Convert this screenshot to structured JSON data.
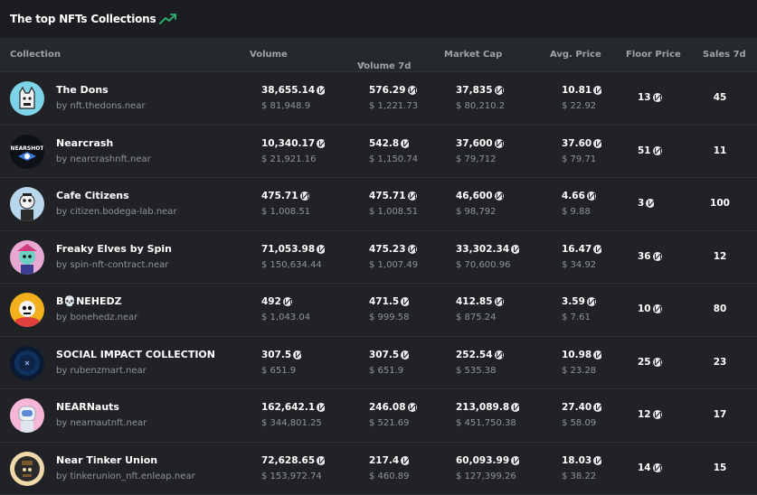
{
  "header": {
    "title": "The top NFTs Collections"
  },
  "icons": {
    "trend": "trending-up-icon",
    "near": "near-token-icon",
    "sort": "sort-ascending-icon"
  },
  "colors": {
    "accent": "#2bb673",
    "background": "#1b1d20",
    "header_row": "#25282c"
  },
  "columns": {
    "collection": "Collection",
    "volume": "Volume",
    "volume_7d": "Volume 7d",
    "market_cap": "Market Cap",
    "avg_price": "Avg. Price",
    "floor_price": "Floor Price",
    "sales_7d": "Sales 7d"
  },
  "rows": [
    {
      "name": "The Dons",
      "contract": "by nft.thedons.near",
      "volume": "38,655.14",
      "volume_usd": "$ 81,948.9",
      "volume_7d": "576.29",
      "volume_7d_usd": "$ 1,221.73",
      "market_cap": "37,835",
      "market_cap_usd": "$ 80,210.2",
      "avg_price": "10.81",
      "avg_price_usd": "$ 22.92",
      "floor": "13",
      "sales": "45"
    },
    {
      "name": "Nearcrash",
      "contract": "by nearcrashnft.near",
      "volume": "10,340.17",
      "volume_usd": "$ 21,921.16",
      "volume_7d": "542.8",
      "volume_7d_usd": "$ 1,150.74",
      "market_cap": "37,600",
      "market_cap_usd": "$ 79,712",
      "avg_price": "37.60",
      "avg_price_usd": "$ 79.71",
      "floor": "51",
      "sales": "11"
    },
    {
      "name": "Cafe Citizens",
      "contract": "by citizen.bodega-lab.near",
      "volume": "475.71",
      "volume_usd": "$ 1,008.51",
      "volume_7d": "475.71",
      "volume_7d_usd": "$ 1,008.51",
      "market_cap": "46,600",
      "market_cap_usd": "$ 98,792",
      "avg_price": "4.66",
      "avg_price_usd": "$ 9.88",
      "floor": "3",
      "sales": "100"
    },
    {
      "name": "Freaky Elves by Spin",
      "contract": "by spin-nft-contract.near",
      "volume": "71,053.98",
      "volume_usd": "$ 150,634.44",
      "volume_7d": "475.23",
      "volume_7d_usd": "$ 1,007.49",
      "market_cap": "33,302.34",
      "market_cap_usd": "$ 70,600.96",
      "avg_price": "16.47",
      "avg_price_usd": "$ 34.92",
      "floor": "36",
      "sales": "12"
    },
    {
      "name": "B💀NEHEDZ",
      "contract": "by bonehedz.near",
      "volume": "492",
      "volume_usd": "$ 1,043.04",
      "volume_7d": "471.5",
      "volume_7d_usd": "$ 999.58",
      "market_cap": "412.85",
      "market_cap_usd": "$ 875.24",
      "avg_price": "3.59",
      "avg_price_usd": "$ 7.61",
      "floor": "10",
      "sales": "80"
    },
    {
      "name": "SOCIAL IMPACT COLLECTION",
      "contract": "by rubenzmart.near",
      "volume": "307.5",
      "volume_usd": "$ 651.9",
      "volume_7d": "307.5",
      "volume_7d_usd": "$ 651.9",
      "market_cap": "252.54",
      "market_cap_usd": "$ 535.38",
      "avg_price": "10.98",
      "avg_price_usd": "$ 23.28",
      "floor": "25",
      "sales": "23"
    },
    {
      "name": "NEARNauts",
      "contract": "by nearnautnft.near",
      "volume": "162,642.1",
      "volume_usd": "$ 344,801.25",
      "volume_7d": "246.08",
      "volume_7d_usd": "$ 521.69",
      "market_cap": "213,089.8",
      "market_cap_usd": "$ 451,750.38",
      "avg_price": "27.40",
      "avg_price_usd": "$ 58.09",
      "floor": "12",
      "sales": "17"
    },
    {
      "name": "Near Tinker Union",
      "contract": "by tinkerunion_nft.enleap.near",
      "volume": "72,628.65",
      "volume_usd": "$ 153,972.74",
      "volume_7d": "217.4",
      "volume_7d_usd": "$ 460.89",
      "market_cap": "60,093.99",
      "market_cap_usd": "$ 127,399.26",
      "avg_price": "18.03",
      "avg_price_usd": "$ 38.22",
      "floor": "14",
      "sales": "15"
    }
  ]
}
